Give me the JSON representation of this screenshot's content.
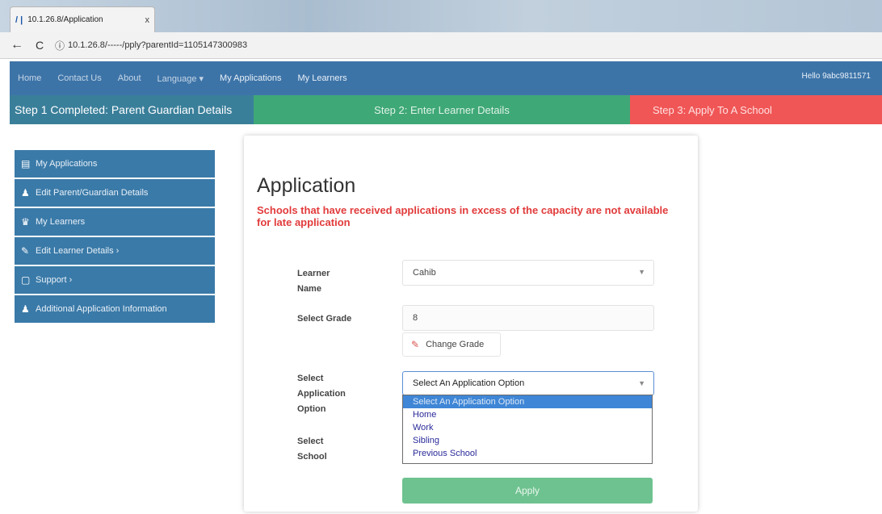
{
  "browser": {
    "tab_title": "10.1.26.8/Application",
    "tab_close": "x",
    "back_icon": "←",
    "reload_icon": "C",
    "info_icon": "ⓘ",
    "url": "10.1.26.8/-----/pply?parentId=1105147300983"
  },
  "nav": {
    "items": [
      "Home",
      "Contact Us",
      "About",
      "Language ▾",
      "My Applications",
      "My Learners"
    ],
    "hello": "Hello 9abc9811571"
  },
  "steps": {
    "step1": "Step 1 Completed: Parent Guardian Details",
    "step2": "Step 2: Enter Learner Details",
    "step3": "Step 3: Apply To A School"
  },
  "sidebar": {
    "items": [
      {
        "icon": "▤",
        "label": "My Applications"
      },
      {
        "icon": "♟",
        "label": "Edit Parent/Guardian Details"
      },
      {
        "icon": "♛",
        "label": "My Learners"
      },
      {
        "icon": "✎",
        "label": "Edit Learner Details ›"
      },
      {
        "icon": "▢",
        "label": "Support ›"
      },
      {
        "icon": "♟",
        "label": "Additional Application Information"
      }
    ]
  },
  "form": {
    "title": "Application",
    "notice": "Schools that have received applications in excess of the capacity are not available for late application",
    "learner_label": "Learner Name",
    "learner_value": "Cahib",
    "grade_label": "Select Grade",
    "grade_value": "8",
    "change_grade": "Change Grade",
    "app_option_label": "Select Application Option",
    "app_option_value": "Select An Application Option",
    "app_options": [
      "Select An Application Option",
      "Home",
      "Work",
      "Sibling",
      "Previous School"
    ],
    "school_label": "Select School",
    "apply": "Apply"
  },
  "colors": {
    "nav": "#3d74a8",
    "step1": "#3a7f9a",
    "step2": "#3fa877",
    "step3": "#f05656",
    "notice": "#e23b3b",
    "apply": "#6ec28f"
  }
}
